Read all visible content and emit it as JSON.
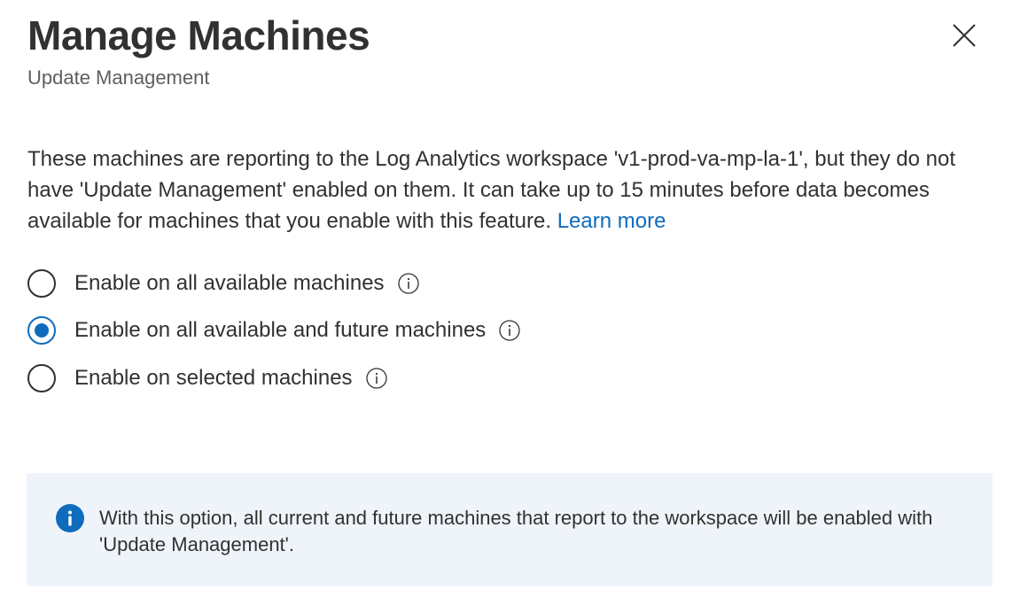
{
  "header": {
    "title": "Manage Machines",
    "subtitle": "Update Management",
    "close_icon": "close-icon"
  },
  "description": {
    "text": "These machines are reporting to the Log Analytics workspace 'v1-prod-va-mp-la-1', but they do not have 'Update Management' enabled on them. It can take up to 15 minutes before data becomes available for machines that you enable with this feature.",
    "link_label": "Learn more"
  },
  "options": [
    {
      "label": "Enable on all available machines",
      "checked": false,
      "icon": "info-circle-icon"
    },
    {
      "label": "Enable on all available and future machines",
      "checked": true,
      "icon": "info-circle-icon"
    },
    {
      "label": "Enable on selected machines",
      "checked": false,
      "icon": "info-circle-icon"
    }
  ],
  "info_banner": {
    "icon": "info-filled-icon",
    "text": "With this option, all current and future machines that report to the workspace will be enabled with 'Update Management'."
  },
  "colors": {
    "accent": "#0f6cbd",
    "banner_background": "#eff4fb",
    "text": "#323130",
    "subtext": "#605e5c"
  }
}
